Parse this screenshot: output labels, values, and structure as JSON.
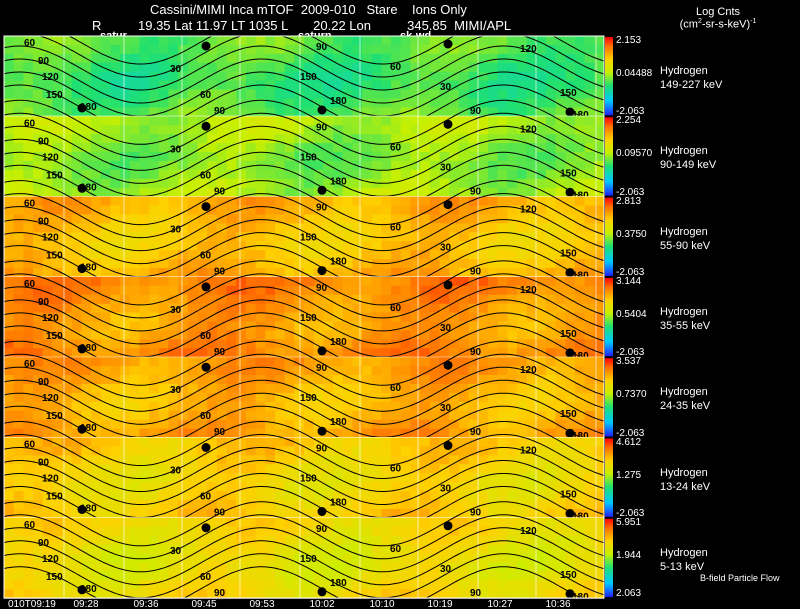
{
  "header": {
    "title": "Cassini/MIMI Inca mTOF  2009-010   Stare    Ions Only",
    "r_label": "R",
    "position": "19.35 Lat 11.97 LT 1035 L       20.22 Lon          345.85  MIMI/APL",
    "annotations": [
      "satur",
      "saturn",
      "sk-wd"
    ]
  },
  "legend": {
    "title_line1": "Log Cnts",
    "title_line2": "(cm",
    "title_line3": "2",
    "title_line4": "-sr-s-keV)",
    "title_line5": "-1"
  },
  "footer_note": "B-field Particle Flow",
  "chart_data": {
    "type": "heatmap",
    "x_tick_labels": [
      "010T09:19",
      "09:28",
      "09:36",
      "09:45",
      "09:53",
      "10:02",
      "10:10",
      "10:19",
      "10:27",
      "10:36"
    ],
    "contour_labels": [
      "30",
      "60",
      "90",
      "120",
      "150",
      "180"
    ],
    "panels": [
      {
        "species": "Hydrogen",
        "energy": "149-227 keV",
        "cb_max": "2.153",
        "cb_mid": "0.04488",
        "cb_min": "-2.063",
        "level": 0.42
      },
      {
        "species": "Hydrogen",
        "energy": "90-149 keV",
        "cb_max": "2.254",
        "cb_mid": "0.09570",
        "cb_min": "-2.063",
        "level": 0.5
      },
      {
        "species": "Hydrogen",
        "energy": "55-90 keV",
        "cb_max": "2.813",
        "cb_mid": "0.3750",
        "cb_min": "-2.063",
        "level": 0.75
      },
      {
        "species": "Hydrogen",
        "energy": "35-55 keV",
        "cb_max": "3.144",
        "cb_mid": "0.5404",
        "cb_min": "-2.063",
        "level": 0.82
      },
      {
        "species": "Hydrogen",
        "energy": "24-35 keV",
        "cb_max": "3.537",
        "cb_mid": "0.7370",
        "cb_min": "-2.063",
        "level": 0.78
      },
      {
        "species": "Hydrogen",
        "energy": "13-24 keV",
        "cb_max": "4.612",
        "cb_mid": "1.275",
        "cb_min": "-2.063",
        "level": 0.7
      },
      {
        "species": "Hydrogen",
        "energy": "5-13 keV",
        "cb_max": "5.951",
        "cb_mid": "1.944",
        "cb_min": "2.063",
        "level": 0.66
      }
    ]
  }
}
